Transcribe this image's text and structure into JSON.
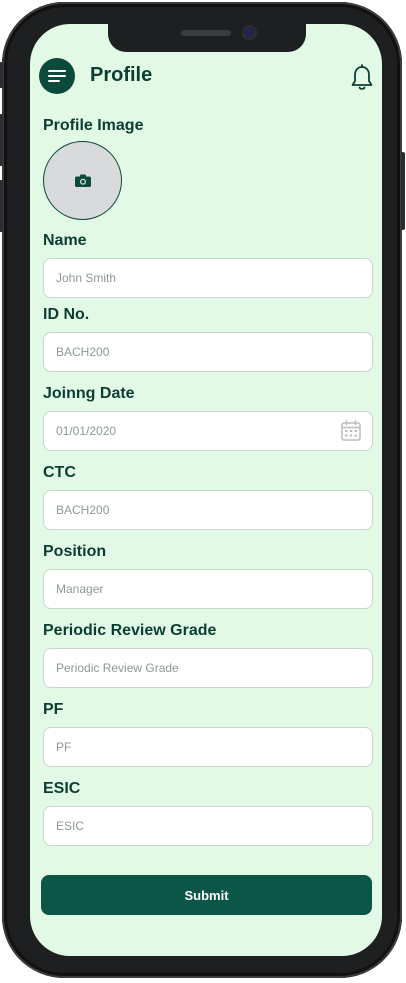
{
  "header": {
    "title": "Profile"
  },
  "form": {
    "profile_image_label": "Profile Image",
    "fields": [
      {
        "label": "Name",
        "placeholder": "John Smith"
      },
      {
        "label": "ID No.",
        "placeholder": "BACH200"
      },
      {
        "label": "Joinng Date",
        "placeholder": "01/01/2020"
      },
      {
        "label": "CTC",
        "placeholder": "BACH200"
      },
      {
        "label": "Position",
        "placeholder": "Manager"
      },
      {
        "label": "Periodic Review Grade",
        "placeholder": "Periodic Review Grade"
      },
      {
        "label": "PF",
        "placeholder": "PF"
      },
      {
        "label": "ESIC",
        "placeholder": "ESIC"
      }
    ],
    "submit_label": "Submit"
  },
  "icons": {
    "menu": "menu-icon",
    "notification": "bell-icon",
    "camera": "camera-icon",
    "calendar": "calendar-icon"
  },
  "colors": {
    "background": "#e2fae5",
    "primary": "#0c4a3c",
    "submit": "#0c5648",
    "text": "#0c3d33"
  }
}
